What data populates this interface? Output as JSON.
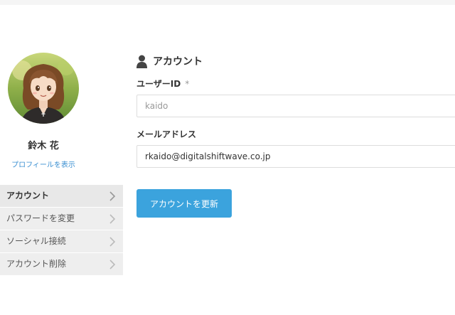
{
  "profile": {
    "name": "鈴木 花",
    "view_profile_label": "プロフィールを表示",
    "avatar_icon": "anime-girl-avatar"
  },
  "sidebar": {
    "items": [
      {
        "label": "アカウント",
        "active": true
      },
      {
        "label": "パスワードを変更",
        "active": false
      },
      {
        "label": "ソーシャル接続",
        "active": false
      },
      {
        "label": "アカウント削除",
        "active": false
      }
    ]
  },
  "main": {
    "section_title": "アカウント",
    "section_icon": "user-icon",
    "userid_label": "ユーザーID",
    "required_mark": "*",
    "userid_value": "kaido",
    "email_label": "メールアドレス",
    "email_value": "rkaido@digitalshiftwave.co.jp",
    "update_button_label": "アカウントを更新"
  },
  "colors": {
    "accent": "#3ba3dd",
    "link": "#3a8fd1",
    "nav_bg": "#eeeeee"
  }
}
